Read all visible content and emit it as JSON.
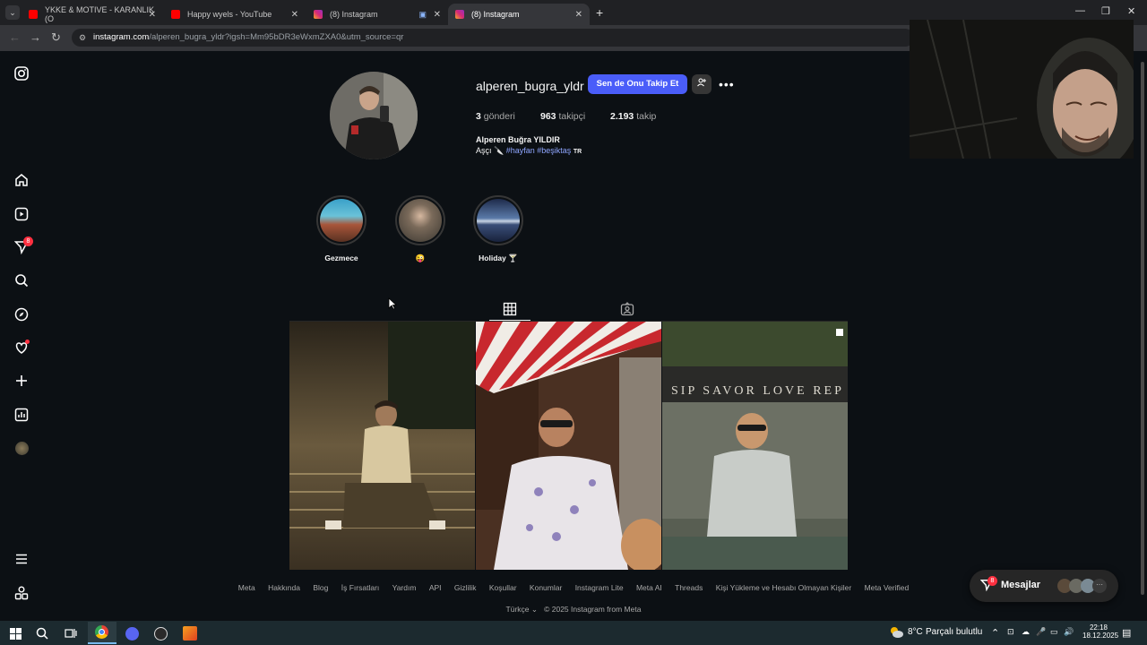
{
  "browser": {
    "tabs": [
      {
        "title": "YKKE & MOTIVE - KARANLIK (O",
        "icon": "youtube-icon",
        "color": "#ff0000"
      },
      {
        "title": "Happy wyels - YouTube",
        "icon": "youtube-icon",
        "color": "#ff0000"
      },
      {
        "title": "(8) Instagram",
        "icon": "instagram-icon",
        "color": "#d62976"
      },
      {
        "title": "(8) Instagram",
        "icon": "instagram-icon",
        "color": "#d62976"
      }
    ],
    "url_host": "instagram.com",
    "url_path": "/alperen_bugra_yldr?igsh=Mm95bDR3eWxmZXA0&utm_source=qr"
  },
  "sidebar": {
    "notifications_badge": "8"
  },
  "profile": {
    "username": "alperen_bugra_yldr",
    "follow_label": "Sen de Onu Takip Et",
    "posts_count": "3",
    "posts_label": "gönderi",
    "followers_count": "963",
    "followers_label": "takipçi",
    "following_count": "2.193",
    "following_label": "takip",
    "full_name": "Alperen Buğra YILDIR",
    "bio_prefix": "Aşçı 🔪",
    "bio_tags": "#hayfan #beşiktaş",
    "bio_suffix": "TR"
  },
  "highlights": [
    {
      "label": "Gezmece"
    },
    {
      "label": "😜"
    },
    {
      "label": "Holiday 🍸"
    }
  ],
  "footer": {
    "links": [
      "Meta",
      "Hakkında",
      "Blog",
      "İş Fırsatları",
      "Yardım",
      "API",
      "Gizlilik",
      "Koşullar",
      "Konumlar",
      "Instagram Lite",
      "Meta AI",
      "Threads",
      "Kişi Yükleme ve Hesabı Olmayan Kişiler",
      "Meta Verified"
    ],
    "language": "Türkçe",
    "copyright": "© 2025 Instagram from Meta"
  },
  "messages": {
    "label": "Mesajlar",
    "badge": "8"
  },
  "post3_sign": "SIP SAVOR LOVE REP",
  "taskbar": {
    "weather_temp": "8°C",
    "weather_text": "Parçalı bulutlu",
    "time": "22:18",
    "date": "18.12.2025"
  }
}
